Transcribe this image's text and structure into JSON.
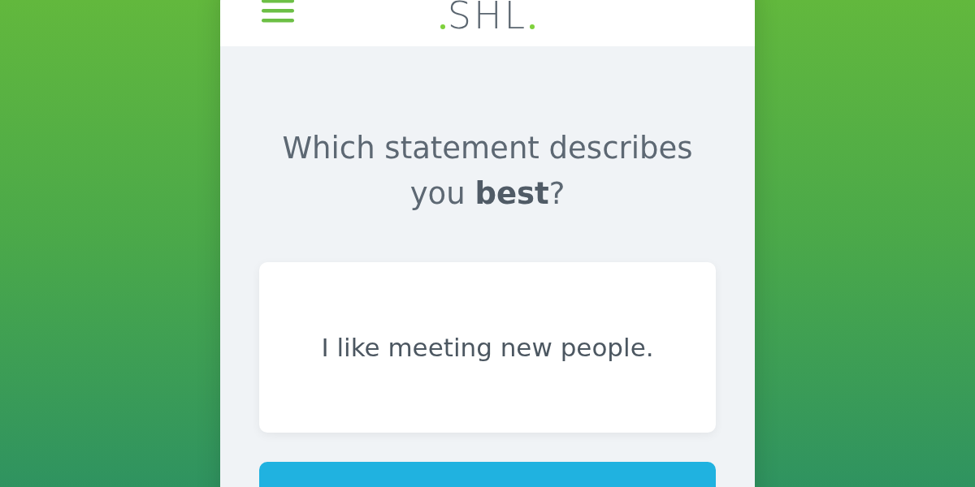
{
  "header": {
    "logo": "SHL"
  },
  "question": "Which statement describes you **best**?",
  "statement": "I like meeting new people."
}
